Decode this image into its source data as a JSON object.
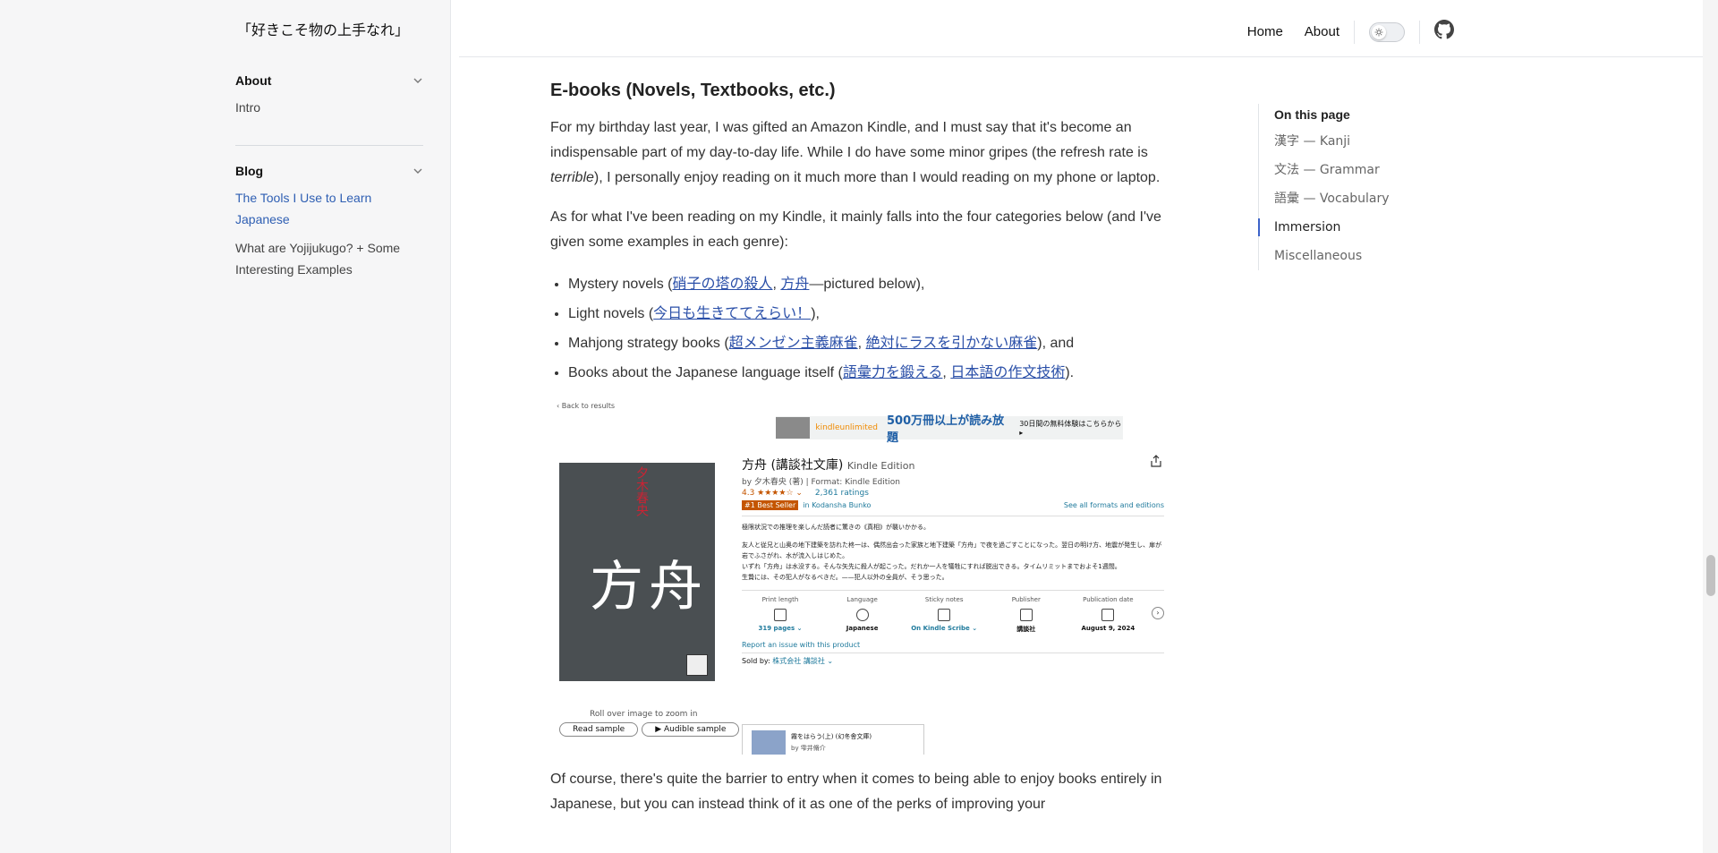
{
  "site": {
    "title": "「好きこそ物の上手なれ」"
  },
  "sidebar": {
    "about": {
      "label": "About",
      "items": [
        {
          "label": "Intro"
        }
      ]
    },
    "blog": {
      "label": "Blog",
      "items": [
        {
          "label": "The Tools I Use to Learn Japanese",
          "active": true
        },
        {
          "label": "What are Yojijukugo? + Some Interesting Examples",
          "active": false
        }
      ]
    }
  },
  "header": {
    "nav": [
      {
        "label": "Home"
      },
      {
        "label": "About"
      }
    ],
    "icons": {
      "theme": "sun-icon",
      "github": "github-icon"
    }
  },
  "article": {
    "heading": "E-books (Novels, Textbooks, etc.)",
    "p1_a": "For my birthday last year, I was gifted an Amazon Kindle, and I must say that it's become an indispensable part of my day-to-day life. While I do have some minor gripes (the refresh rate is ",
    "p1_em": "terrible",
    "p1_b": "), I personally enjoy reading on it much more than I would reading on my phone or laptop.",
    "p2": "As for what I've been reading on my Kindle, it mainly falls into the four categories below (and I've given some examples in each genre):",
    "list": {
      "li1_pre": "Mystery novels (",
      "li1_link1": "硝子の塔の殺人",
      "li1_sep": ", ",
      "li1_link2": "方舟",
      "li1_post": "—pictured below),",
      "li2_pre": "Light novels (",
      "li2_link1": "今日も生きててえらい！",
      "li2_post": "),",
      "li3_pre": "Mahjong strategy books (",
      "li3_link1": "超メンゼン主義麻雀",
      "li3_sep": ", ",
      "li3_link2": "絶対にラスを引かない麻雀",
      "li3_post": "), and",
      "li4_pre": "Books about the Japanese language itself (",
      "li4_link1": "語彙力を鍛える",
      "li4_sep": ", ",
      "li4_link2": "日本語の作文技術",
      "li4_post": ")."
    },
    "p3": "Of course, there's quite the barrier to entry when it comes to being able to enjoy books entirely in Japanese, but you can instead think of it as one of the perks of improving your"
  },
  "screenshot": {
    "back": "‹ Back to results",
    "ku_logo": "kindleunlimited",
    "ku_text": "500万冊以上が読み放題",
    "ku_small": "30日間の無料体験はこちらから ▸",
    "cover_title": "方舟",
    "cover_author": "夕木春央",
    "roll_over": "Roll over image to zoom in",
    "read_sample": "Read sample",
    "audible_sample": "▶ Audible sample",
    "title": "方舟 (講談社文庫)",
    "edition": "Kindle Edition",
    "byline": "by 夕木春央 (著)  |  Format: Kindle Edition",
    "rating": "4.3 ★★★★☆ ⌄",
    "ratings_count": "2,361 ratings",
    "best_seller": "#1 Best Seller",
    "category": "in Kodansha Bunko",
    "see_all": "See all formats and editions",
    "desc1": "極限状況での推理を楽しんだ読者に驚きの《真相》が襲いかかる。",
    "desc2": "友人と従兄と山奥の地下建築を訪れた柊一は、偶然出会った家族と地下建築「方舟」で夜を過ごすことになった。翌日の明け方、地震が発生し、扉が岩でふさがれ、水が流入しはじめた。",
    "desc3": "いずれ「方舟」は水没する。そんな矢先に殺人が起こった。だれか一人を犠牲にすれば脱出できる。タイムリミットまでおよそ1週間。",
    "desc4": "生贄には、その犯人がなるべきだ。——犯人以外の全員が、そう思った。",
    "meta": [
      {
        "label": "Print length",
        "value": "319 pages ⌄",
        "link": true
      },
      {
        "label": "Language",
        "value": "Japanese",
        "link": false
      },
      {
        "label": "Sticky notes",
        "value": "On Kindle Scribe ⌄",
        "link": true
      },
      {
        "label": "Publisher",
        "value": "講談社",
        "link": false
      },
      {
        "label": "Publication date",
        "value": "August 9, 2024",
        "link": false
      }
    ],
    "report": "Report an issue with this product",
    "sold_by_label": "Sold by: ",
    "sold_by": "株式会社 講談社 ⌄",
    "series_title": "霧をはらう(上) (幻冬舎文庫)",
    "series_by": "by 雫井脩介"
  },
  "toc": {
    "title": "On this page",
    "items": [
      {
        "label": "漢字 — Kanji",
        "active": false
      },
      {
        "label": "文法 — Grammar",
        "active": false
      },
      {
        "label": "語彙 — Vocabulary",
        "active": false
      },
      {
        "label": "Immersion",
        "active": true
      },
      {
        "label": "Miscellaneous",
        "active": false
      }
    ]
  },
  "colors": {
    "accent": "#3c63c9",
    "link": "#2a4fa8",
    "sidebar_bg": "#f6f6f7"
  }
}
